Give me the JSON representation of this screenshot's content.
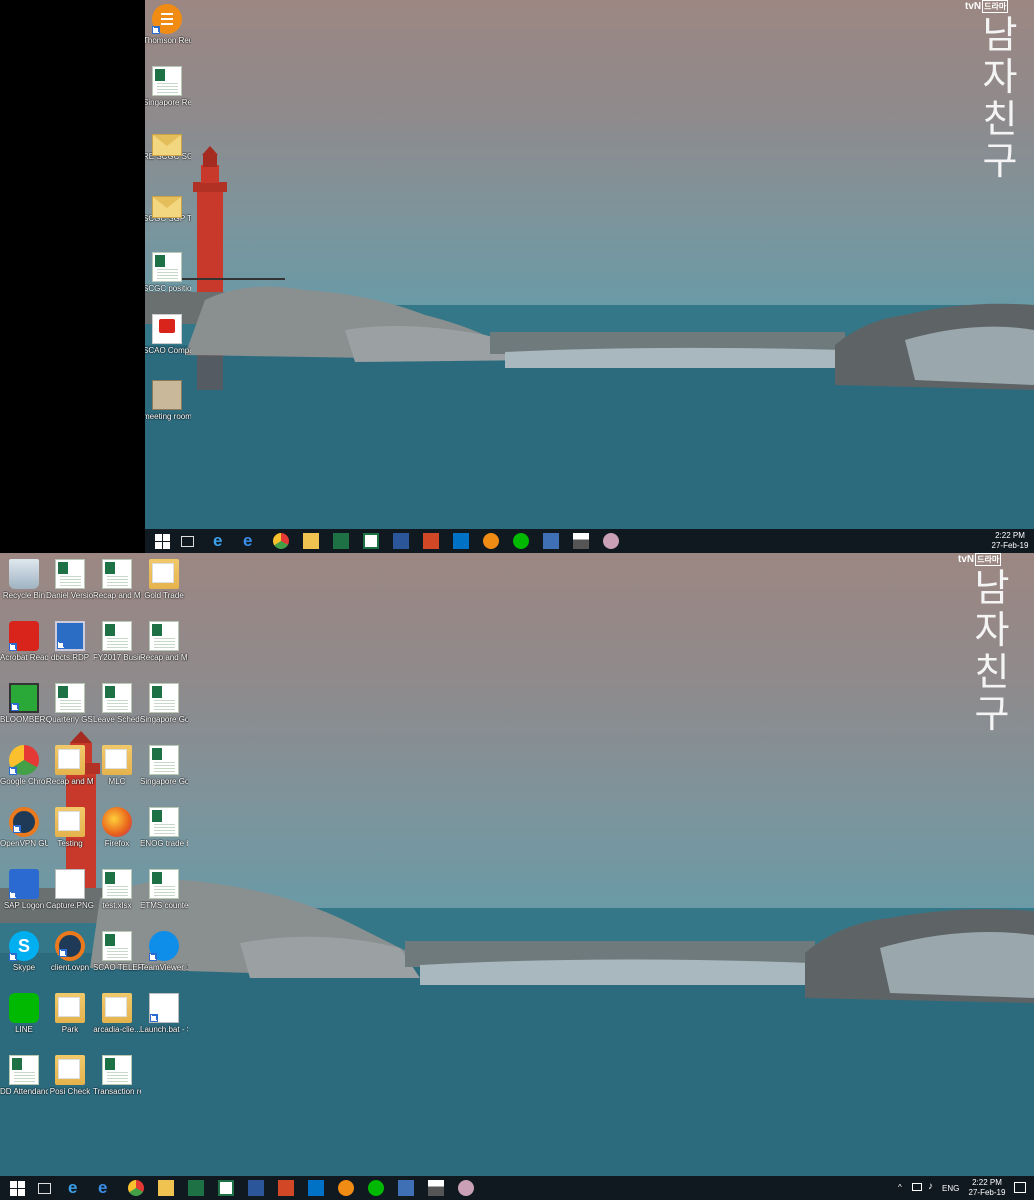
{
  "top_screen": {
    "watermark": {
      "brand": "tvN",
      "badge": "드라마",
      "title_chars": [
        "남",
        "자",
        "친",
        "구"
      ]
    },
    "icons": [
      {
        "name": "thomson-reuters-eikon-icon",
        "label": "Thomson Reuters Eik...",
        "kind": "eikon"
      },
      {
        "name": "singapore-recap-icon",
        "label": "Singapore Recap a...",
        "kind": "excel"
      },
      {
        "name": "re-scgc-sgp-trade-icon",
        "label": "RE  SCGC SGP Trade...",
        "kind": "mail"
      },
      {
        "name": "scgc-sgp-trade-upl-icon",
        "label": "SCGC SGP Trade Upl...",
        "kind": "mail"
      },
      {
        "name": "scgc-position-icon",
        "label": "SCGC position.xlsx",
        "kind": "excel"
      },
      {
        "name": "scao-compa-icon",
        "label": "SCAO Compa...",
        "kind": "pdf"
      },
      {
        "name": "meeting-room-icon",
        "label": "meeting room refer...",
        "kind": "image"
      }
    ],
    "clock": {
      "time": "2:22 PM",
      "date": "27-Feb-19"
    }
  },
  "bottom_screen": {
    "watermark": {
      "brand": "tvN",
      "badge": "드라마",
      "title_chars": [
        "남",
        "자",
        "친",
        "구"
      ]
    },
    "icons": [
      {
        "name": "recycle-bin-icon",
        "label": "Recycle Bin",
        "kind": "recycle"
      },
      {
        "name": "daniel-version-icon",
        "label": "Daniel Version - Si...",
        "kind": "excel"
      },
      {
        "name": "recap-margin-che-icon",
        "label": "Recap and Margin che...",
        "kind": "excel"
      },
      {
        "name": "gold-trade-icon",
        "label": "Gold Trade",
        "kind": "folder"
      },
      {
        "name": "acrobat-reader-icon",
        "label": "Acrobat Reader DC",
        "kind": "acrobat"
      },
      {
        "name": "dbcts-rdp-icon",
        "label": "dbcts.RDP",
        "kind": "rdp"
      },
      {
        "name": "fy2017-business-icon",
        "label": "FY2017 Business Tri...",
        "kind": "excel"
      },
      {
        "name": "recap-margin-2-icon",
        "label": "Recap and Margin ...",
        "kind": "excel"
      },
      {
        "name": "bloomberg-icon",
        "label": "BLOOMBERG",
        "kind": "bloomberg"
      },
      {
        "name": "quarterly-gst-icon",
        "label": "Quarterly GST excel.xlsx",
        "kind": "excel"
      },
      {
        "name": "leave-schedule-icon",
        "label": "Leave Schedule.xlsx",
        "kind": "excel"
      },
      {
        "name": "singapore-gold-opera-icon",
        "label": "Singapore Gold Opera...",
        "kind": "excel"
      },
      {
        "name": "google-chrome-icon",
        "label": "Google Chrome",
        "kind": "chrome"
      },
      {
        "name": "recap-margin-folder-icon",
        "label": "Recap and Margin",
        "kind": "folder"
      },
      {
        "name": "mlc-folder-icon",
        "label": "MLC",
        "kind": "folder"
      },
      {
        "name": "singapore-gold-oper-2-icon",
        "label": "Singapore Gold Oper...",
        "kind": "excel"
      },
      {
        "name": "openvpn-gui-icon",
        "label": "OpenVPN GUI",
        "kind": "openvpn"
      },
      {
        "name": "testing-folder-icon",
        "label": "Testing",
        "kind": "folder"
      },
      {
        "name": "firefox-icon",
        "label": "Firefox",
        "kind": "firefox"
      },
      {
        "name": "enog-trade-book-icon",
        "label": "ENOG trade book kee...",
        "kind": "excel"
      },
      {
        "name": "sap-logon-icon",
        "label": "SAP Logon",
        "kind": "sap"
      },
      {
        "name": "capture-png-icon",
        "label": "Capture.PNG",
        "kind": "png"
      },
      {
        "name": "test-xlsx-icon",
        "label": "test.xlsx",
        "kind": "excel"
      },
      {
        "name": "etms-counterpar-icon",
        "label": "ETMS counterpar...",
        "kind": "excel"
      },
      {
        "name": "skype-icon",
        "label": "Skype",
        "kind": "skype"
      },
      {
        "name": "client-ovpn-icon",
        "label": "client.ovpn",
        "kind": "openvpn"
      },
      {
        "name": "scao-telephon-icon",
        "label": "SCAO TELEPHON...",
        "kind": "excel"
      },
      {
        "name": "teamviewer-icon",
        "label": "TeamViewer 13",
        "kind": "teamviewer"
      },
      {
        "name": "line-icon",
        "label": "LINE",
        "kind": "line"
      },
      {
        "name": "park-folder-icon",
        "label": "Park",
        "kind": "folder"
      },
      {
        "name": "arcadia-client-icon",
        "label": "arcadia-clie...",
        "kind": "folder"
      },
      {
        "name": "launch-bat-icon",
        "label": "Launch.bat - Shortcut",
        "kind": "launch"
      },
      {
        "name": "dd-attendance-icon",
        "label": "DD Attendanc...",
        "kind": "excel"
      },
      {
        "name": "posi-check-icon",
        "label": "Posi Check",
        "kind": "folder"
      },
      {
        "name": "transaction-reporting-icon",
        "label": "Transaction reporting ...",
        "kind": "excel"
      }
    ],
    "tray": {
      "language": "ENG"
    },
    "clock": {
      "time": "2:22 PM",
      "date": "27-Feb-19"
    }
  },
  "taskbar_apps": [
    "windows-start-icon",
    "task-view-icon",
    "ie-icon",
    "edge-icon",
    "chrome-icon",
    "file-explorer-icon",
    "excel-icon",
    "excel-file-icon",
    "word-icon",
    "powerpoint-icon",
    "outlook-icon",
    "eikon-icon",
    "line-icon",
    "rdp-icon",
    "photos-icon",
    "misc-app-icon"
  ]
}
